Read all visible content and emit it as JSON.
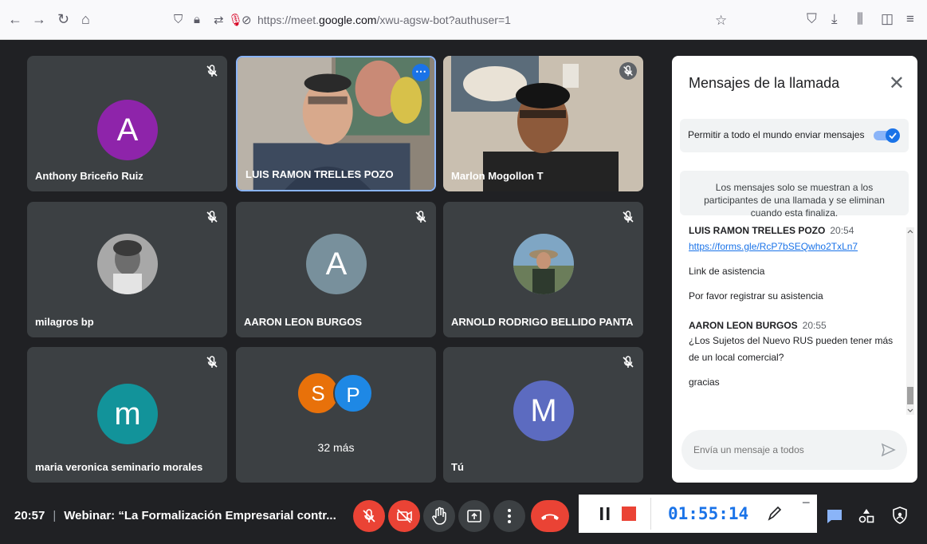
{
  "browser": {
    "url_prefix": "https://meet.",
    "url_domain": "google.com",
    "url_suffix": "/xwu-agsw-bot?authuser=1"
  },
  "tiles": [
    {
      "name": "Anthony Briceño Ruiz",
      "initial": "A",
      "color": "#8e24aa"
    },
    {
      "name": "LUIS RAMON TRELLES POZO"
    },
    {
      "name": "Marlon Mogollon T"
    },
    {
      "name": "milagros bp"
    },
    {
      "name": "AARON LEON BURGOS",
      "initial": "A",
      "color": "#78909c"
    },
    {
      "name": "ARNOLD RODRIGO BELLIDO PANTA"
    },
    {
      "name": "maria veronica seminario morales",
      "initial": "m",
      "color": "#12939a"
    },
    {
      "name": "32 más",
      "initials": [
        "S",
        "P"
      ],
      "colors": [
        "#e8710a",
        "#1e88e5"
      ]
    },
    {
      "name": "Tú",
      "initial": "M",
      "color": "#5c6bc0"
    }
  ],
  "chat": {
    "title": "Mensajes de la llamada",
    "toggle_label": "Permitir a todo el mundo enviar mensajes",
    "toggle_on": true,
    "notice": "Los mensajes solo se muestran a los participantes de una llamada y se eliminan cuando esta finaliza.",
    "messages": [
      {
        "sender": "LUIS RAMON TRELLES POZO",
        "time": "20:54",
        "lines": [
          "https://forms.gle/RcP7bSEQwho2TxLn7",
          "Link de asistencia",
          "Por favor registrar su asistencia"
        ]
      },
      {
        "sender": "AARON LEON BURGOS",
        "time": "20:55",
        "lines": [
          "¿Los Sujetos del Nuevo RUS pueden tener más de un local comercial?",
          "gracias"
        ]
      }
    ],
    "compose_placeholder": "Envía un mensaje a todos"
  },
  "bottom": {
    "time": "20:57",
    "meeting_title": "Webinar: “La Formalización Empresarial contr..."
  },
  "recorder": {
    "elapsed": "01:55:14"
  },
  "colors": {
    "accent": "#1a73e8",
    "danger": "#ea4335"
  }
}
